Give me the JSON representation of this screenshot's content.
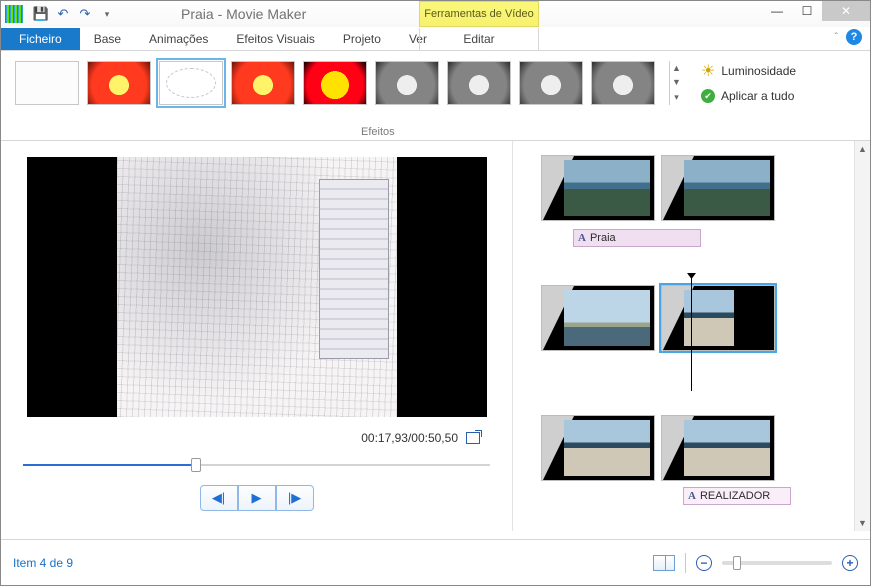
{
  "window": {
    "title": "Praia - Movie Maker",
    "context_tool_label": "Ferramentas de Vídeo"
  },
  "ribbon": {
    "file_tab": "Ficheiro",
    "tabs": [
      "Base",
      "Animações",
      "Efeitos Visuais",
      "Projeto",
      "Ver"
    ],
    "context_tab": "Editar",
    "group_label": "Efeitos",
    "luminosity": "Luminosidade",
    "apply_all": "Aplicar a tudo"
  },
  "preview": {
    "time_readout": "00:17,93/00:50,50"
  },
  "timeline": {
    "title_caption_1": "Praia",
    "title_caption_2": "REALIZADOR"
  },
  "status": {
    "item_text": "Item 4 de 9"
  },
  "zoom": {
    "minus": "−",
    "plus": "+"
  }
}
